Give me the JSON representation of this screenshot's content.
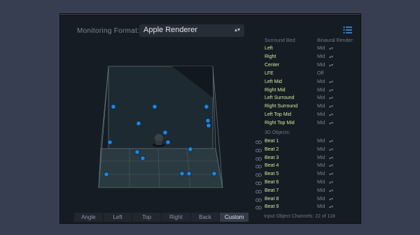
{
  "monitoring": {
    "label": "Monitoring Format:",
    "value": "Apple Renderer"
  },
  "icons": {
    "list": "list-icon",
    "chevron": "updown-chevron-icon",
    "link": "link-icon",
    "listener": "listener-head-icon"
  },
  "colors": {
    "object_dot": "#1e86e0",
    "name_text": "#cfe9a0",
    "panel_bg": "#161c23",
    "desktop_bg": "#373e51"
  },
  "surround_bed": {
    "header": "Surround Bed:",
    "render_header": "Binaural Render:",
    "rows": [
      {
        "name": "Left",
        "value": "Mid"
      },
      {
        "name": "Right",
        "value": "Mid"
      },
      {
        "name": "Center",
        "value": "Mid"
      },
      {
        "name": "LFE",
        "value": "Off"
      },
      {
        "name": "Left Mid",
        "value": "Mid"
      },
      {
        "name": "Right Mid",
        "value": "Mid"
      },
      {
        "name": "Left Surround",
        "value": "Mid"
      },
      {
        "name": "Right Surround",
        "value": "Mid"
      },
      {
        "name": "Left Top Mid",
        "value": "Mid"
      },
      {
        "name": "Right Top Mid",
        "value": "Mid"
      }
    ]
  },
  "objects": {
    "header": "3D Objects:",
    "rows": [
      {
        "name": "Beat 1",
        "value": "Mid"
      },
      {
        "name": "Beat 2",
        "value": "Mid"
      },
      {
        "name": "Beat 3",
        "value": "Mid"
      },
      {
        "name": "Beat 4",
        "value": "Mid"
      },
      {
        "name": "Beat 5",
        "value": "Mid"
      },
      {
        "name": "Beat 6",
        "value": "Mid"
      },
      {
        "name": "Beat 7",
        "value": "Mid"
      },
      {
        "name": "Beat 8",
        "value": "Mid"
      },
      {
        "name": "Beat 9",
        "value": "Mid"
      }
    ]
  },
  "channels": "Input Object Channels: 22 of 118",
  "views": [
    {
      "label": "Angle",
      "active": false
    },
    {
      "label": "Left",
      "active": false
    },
    {
      "label": "Top",
      "active": false
    },
    {
      "label": "Right",
      "active": false
    },
    {
      "label": "Back",
      "active": false
    },
    {
      "label": "Custom",
      "active": true
    }
  ]
}
